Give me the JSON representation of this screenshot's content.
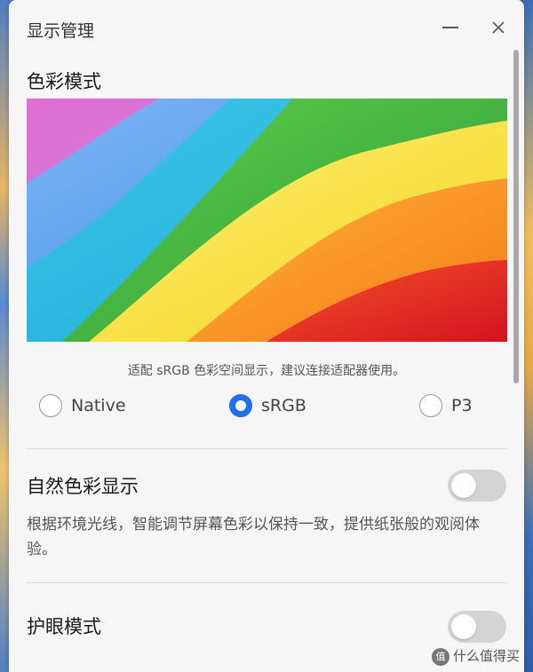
{
  "window": {
    "title": "显示管理"
  },
  "color_mode": {
    "heading": "色彩模式",
    "note": "适配 sRGB 色彩空间显示，建议连接适配器使用。",
    "options": [
      {
        "label": "Native",
        "selected": false
      },
      {
        "label": "sRGB",
        "selected": true
      },
      {
        "label": "P3",
        "selected": false
      }
    ]
  },
  "natural_color": {
    "heading": "自然色彩显示",
    "enabled": false,
    "description": "根据环境光线，智能调节屏幕色彩以保持一致，提供纸张般的观阅体验。"
  },
  "eye_care": {
    "heading": "护眼模式",
    "enabled": false
  },
  "watermark": {
    "badge": "值",
    "text": "什么值得买"
  },
  "colors": {
    "accent": "#1f6ff0",
    "toggle_off": "#d4d4d4"
  }
}
